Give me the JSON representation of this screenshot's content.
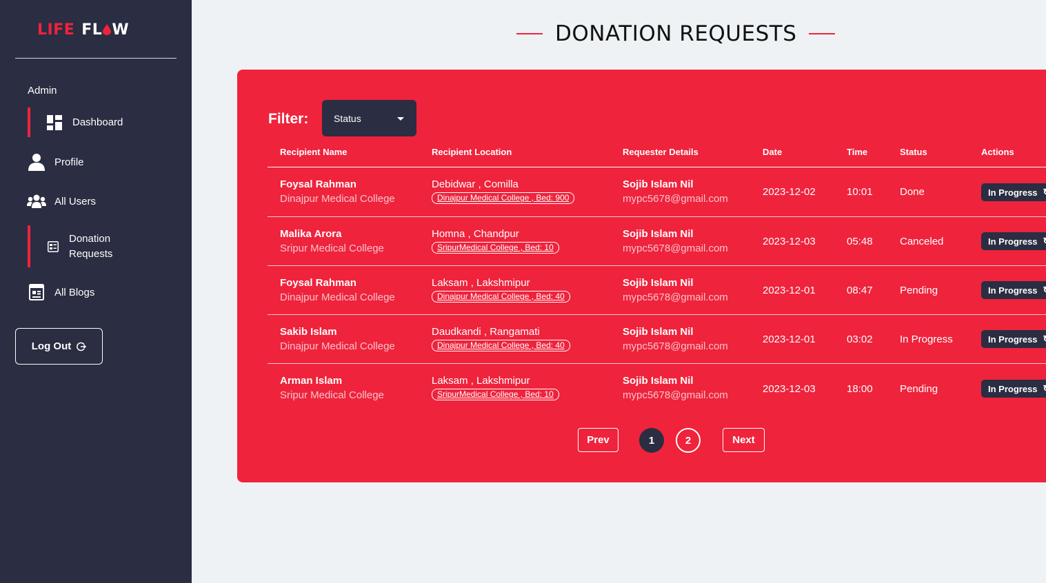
{
  "brand": {
    "logo_left": "LIFE",
    "logo_right_a": "FL",
    "logo_right_b": "W",
    "accent": "#ef233c",
    "dark": "#2b2d42"
  },
  "sidebar": {
    "section_label": "Admin",
    "items": [
      {
        "label": "Dashboard",
        "icon": "dashboard-icon"
      },
      {
        "label": "Profile",
        "icon": "user-icon"
      },
      {
        "label": "All Users",
        "icon": "users-icon"
      },
      {
        "label_line1": "Donation",
        "label_line2": "Requests",
        "icon": "list-icon"
      },
      {
        "label": "All Blogs",
        "icon": "blog-icon"
      }
    ],
    "logout_label": "Log Out"
  },
  "page": {
    "title": "DONATION REQUESTS"
  },
  "filter": {
    "label": "Filter:",
    "selected": "Status"
  },
  "table": {
    "headers": [
      "Recipient Name",
      "Recipient Location",
      "Requester Details",
      "Date",
      "Time",
      "Status",
      "Actions"
    ],
    "rows": [
      {
        "recipient_name": "Foysal Rahman",
        "hospital": "Dinajpur Medical College",
        "location": "Debidwar , Comilla",
        "bed": "Dinajpur Medical College , Bed: 900",
        "requester_name": "Sojib Islam Nil",
        "requester_email": "mypc5678@gmail.com",
        "date": "2023-12-02",
        "time": "10:01",
        "status": "Done",
        "action": "In Progress"
      },
      {
        "recipient_name": "Malika Arora",
        "hospital": "Sripur Medical College",
        "location": "Homna , Chandpur",
        "bed": "SripurMedical College , Bed: 10",
        "requester_name": "Sojib Islam Nil",
        "requester_email": "mypc5678@gmail.com",
        "date": "2023-12-03",
        "time": "05:48",
        "status": "Canceled",
        "action": "In Progress"
      },
      {
        "recipient_name": "Foysal Rahman",
        "hospital": "Dinajpur Medical College",
        "location": "Laksam , Lakshmipur",
        "bed": "Dinajpur Medical College , Bed: 40",
        "requester_name": "Sojib Islam Nil",
        "requester_email": "mypc5678@gmail.com",
        "date": "2023-12-01",
        "time": "08:47",
        "status": "Pending",
        "action": "In Progress"
      },
      {
        "recipient_name": "Sakib Islam",
        "hospital": "Dinajpur Medical College",
        "location": "Daudkandi , Rangamati",
        "bed": "Dinajpur Medical College , Bed: 40",
        "requester_name": "Sojib Islam Nil",
        "requester_email": "mypc5678@gmail.com",
        "date": "2023-12-01",
        "time": "03:02",
        "status": "In Progress",
        "action": "In Progress"
      },
      {
        "recipient_name": "Arman Islam",
        "hospital": "Sripur Medical College",
        "location": "Laksam , Lakshmipur",
        "bed": "SripurMedical College , Bed: 10",
        "requester_name": "Sojib Islam Nil",
        "requester_email": "mypc5678@gmail.com",
        "date": "2023-12-03",
        "time": "18:00",
        "status": "Pending",
        "action": "In Progress"
      }
    ]
  },
  "pagination": {
    "prev": "Prev",
    "pages": [
      "1",
      "2"
    ],
    "current": "1",
    "next": "Next"
  }
}
